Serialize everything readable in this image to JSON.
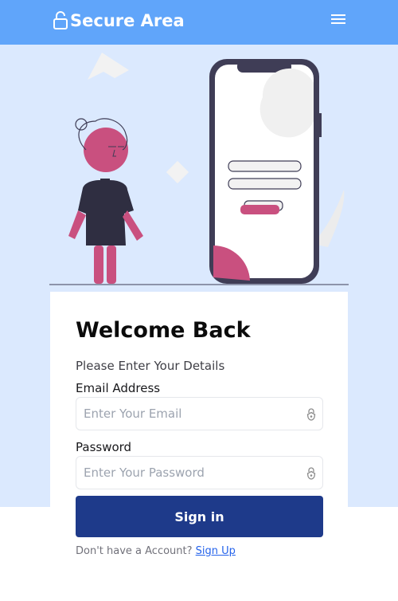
{
  "navbar": {
    "brand_title": "Secure Area",
    "brand_icon": "lock-icon",
    "menu_icon": "hamburger-menu-icon",
    "background_color": "#60a5fa"
  },
  "illustration": {
    "name": "person-with-phone-illustration"
  },
  "login_form": {
    "title": "Welcome Back",
    "subtitle": "Please Enter Your Details",
    "email_label": "Email Address",
    "email_placeholder": "Enter Your Email",
    "email_value": "",
    "password_label": "Password",
    "password_placeholder": "Enter Your Password",
    "password_value": "",
    "field_icon": "lock-icon",
    "signin_label": "Sign in",
    "signup_prompt": "Don't have a Account?",
    "signup_link": "Sign Up"
  },
  "colors": {
    "page_background": "#dbe9fe",
    "primary_button": "#1e3a8a",
    "accent_pink": "#c9507f",
    "link": "#2563eb"
  }
}
